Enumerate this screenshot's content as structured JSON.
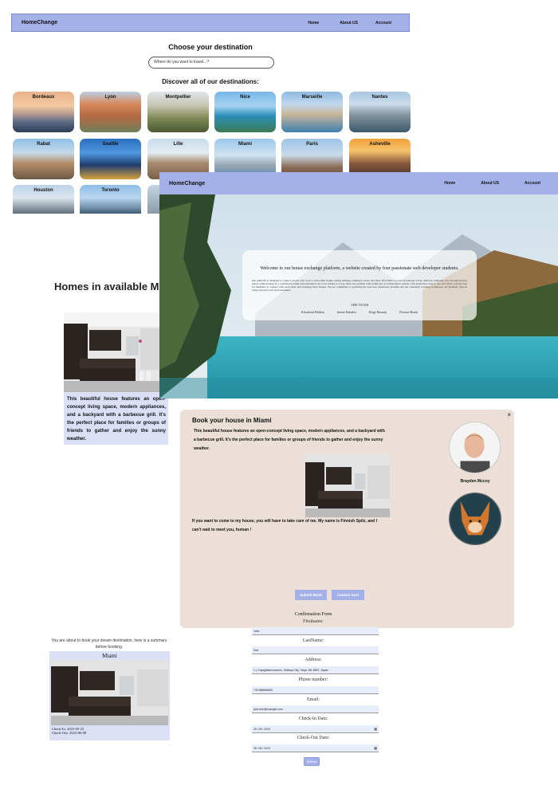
{
  "destinations_page": {
    "brand": "HomeChange",
    "nav": [
      "Home",
      "About US",
      "Account"
    ],
    "title": "Choose your destination",
    "search_placeholder": "Where do you want to travel...?",
    "subtitle": "Discover all of our destinations:",
    "cities": [
      "Bordeaux",
      "Lyon",
      "Montpellier",
      "Nice",
      "Marseille",
      "Nantes",
      "Rabat",
      "Seattle",
      "Lille",
      "Miami",
      "Paris",
      "Asheville",
      "Houston",
      "Toronto"
    ]
  },
  "welcome_page": {
    "brand": "HomeChange",
    "nav": [
      "Home",
      "About US",
      "Account"
    ],
    "heading": "Welcome to our house exchange platform, a website created by four passionate web developer students.",
    "paragraph": "Our platform is designed to connect people who want to share their homes during holidays, making it easier and more affordable to travel around the world. With our platform, you can explore new places while staying in a comfortable home and experience the local culture in a way that's not possible with traditional accommodation options. Our platform is easy to use and offers a secure way for members to connect with each other and exchange their houses. We are committed to providing the best user experience possible and are constantly working to improve our platform. Join us today and start your next adventure!",
    "team_label": "THE TEAM",
    "members": [
      "Khouloud Belkhir",
      "Imene Rahabsi",
      "Birge Hassenj",
      "Florent Mazin"
    ]
  },
  "homes_page": {
    "title": "Homes in available Miami",
    "description": "This beautiful house features an open-concept living space, modern appliances, and a backyard with a barbecue grill. It's the perfect place for families or groups of friends to gather and enjoy the sunny weather."
  },
  "booking_page": {
    "title": "Book your house in Miami",
    "description": "This beautiful house features an open-concept living space, modern appliances, and a backyard with a barbecue grill. It's the perfect place for families or groups of friends to gather and enjoy the sunny weather.",
    "pet_note": "If you want to come to my house, you will have to take care of me. My name is Finnish Spitz, and I can't wait to meet you, human !",
    "submit_label": "Submit Book",
    "contact_label": "Contact host",
    "host_name": "Brayden Mccoy",
    "close_icon": "×"
  },
  "summary_page": {
    "intro": "You are about to book your dream destination, here is a summary before booking.",
    "city": "Miami",
    "check_in": "Check-In: 2023-05-25",
    "check_out": "Check-Out: 2023-06-08"
  },
  "confirmation_form": {
    "title": "Confirmation Form",
    "fields": [
      {
        "label": "Firstname:",
        "value": "John"
      },
      {
        "label": "LastName:",
        "value": "Doe"
      },
      {
        "label": "Address:",
        "value": "1-1 Yoyogikamizonocho, Shibuya City, Tokyo 151-8557, Japan"
      },
      {
        "label": "Phone number:",
        "value": "+33 666666653"
      },
      {
        "label": "Email:",
        "value": "john.doe@example.com"
      },
      {
        "label": "Check-In Date:",
        "value": "25 / 05 / 2023"
      },
      {
        "label": "Check-Out Date:",
        "value": "08 / 06 / 2023"
      }
    ],
    "submit_label": "Submit"
  },
  "colors": {
    "nav": "#a4b0e8",
    "panel": "#dbe0f6",
    "booking_bg": "#ecdfd7"
  }
}
